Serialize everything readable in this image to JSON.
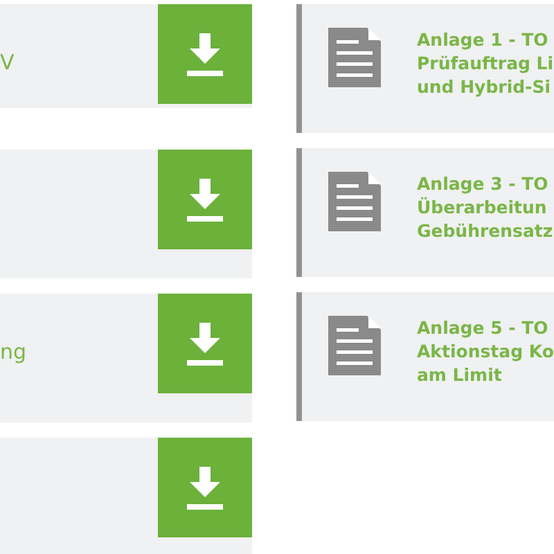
{
  "downloads": [
    {
      "kind": "labelled",
      "label": "V"
    },
    {
      "kind": "blank"
    },
    {
      "kind": "labelled",
      "label": "ng"
    },
    {
      "kind": "blank"
    }
  ],
  "attachments": [
    {
      "title_lines": [
        "Anlage 1 - TO",
        "Prüfauftrag Li",
        "und Hybrid-Si"
      ]
    },
    {
      "title_lines": [
        "Anlage 3 - TO",
        "Überarbeitun",
        "Gebührensatz"
      ]
    },
    {
      "title_lines": [
        "Anlage 5 - TO",
        "Aktionstag Ko",
        "am Limit"
      ]
    }
  ]
}
